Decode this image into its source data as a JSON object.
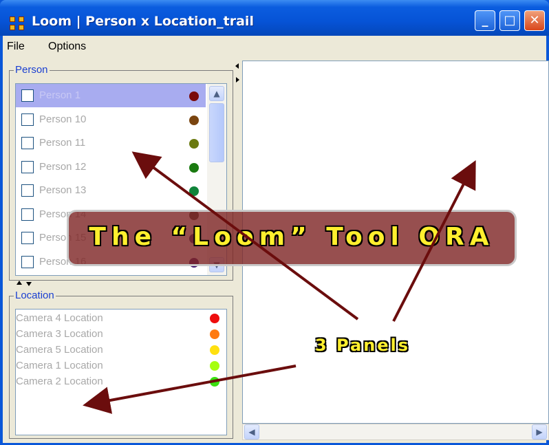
{
  "window": {
    "title": "Loom | Person x Location_trail",
    "buttons": {
      "minimize": "_",
      "maximize": "□",
      "close": "✕"
    }
  },
  "menu": {
    "items": [
      "File",
      "Options"
    ]
  },
  "person_panel": {
    "legend": "Person",
    "items": [
      {
        "label": "Person 1",
        "color": "#7a0a0a",
        "selected": true
      },
      {
        "label": "Person 10",
        "color": "#7a4510",
        "selected": false
      },
      {
        "label": "Person 11",
        "color": "#6b7a10",
        "selected": false
      },
      {
        "label": "Person 12",
        "color": "#1a7a10",
        "selected": false
      },
      {
        "label": "Person 13",
        "color": "#10843a",
        "selected": false
      },
      {
        "label": "Person 14",
        "color": "#3a3a28",
        "selected": false
      },
      {
        "label": "Person 15",
        "color": "#1a1a6a",
        "selected": false
      },
      {
        "label": "Person 16",
        "color": "#3a106a",
        "selected": false
      }
    ]
  },
  "location_panel": {
    "legend": "Location",
    "items": [
      {
        "label": "Camera 4 Location",
        "color": "#ee0d0d"
      },
      {
        "label": "Camera 3 Location",
        "color": "#ff7a10"
      },
      {
        "label": "Camera 5 Location",
        "color": "#ffe010"
      },
      {
        "label": "Camera 1 Location",
        "color": "#a6ff10"
      },
      {
        "label": "Camera 2 Location",
        "color": "#3ae010"
      }
    ]
  },
  "overlay": {
    "banner": "The “Loom” Tool ORA",
    "callout": "3 Panels",
    "arrow_color": "#6b0d0d"
  }
}
